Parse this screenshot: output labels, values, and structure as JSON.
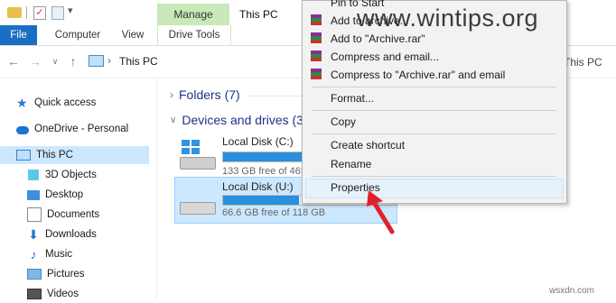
{
  "window": {
    "title": "This PC",
    "manage_tab": "Manage"
  },
  "ribbon": {
    "tabs": [
      "File",
      "Computer",
      "View",
      "Drive Tools"
    ]
  },
  "address": {
    "path": "This PC",
    "path_right_fragment": "This PC"
  },
  "sidebar": {
    "items": [
      {
        "label": "Quick access",
        "icon": "star-icon"
      },
      {
        "label": "OneDrive - Personal",
        "icon": "cloud-icon"
      },
      {
        "label": "This PC",
        "icon": "computer-icon",
        "selected": true
      },
      {
        "label": "3D Objects",
        "icon": "cube-icon"
      },
      {
        "label": "Desktop",
        "icon": "desktop-folder-icon"
      },
      {
        "label": "Documents",
        "icon": "documents-icon"
      },
      {
        "label": "Downloads",
        "icon": "download-icon"
      },
      {
        "label": "Music",
        "icon": "music-icon"
      },
      {
        "label": "Pictures",
        "icon": "pictures-icon"
      },
      {
        "label": "Videos",
        "icon": "videos-icon"
      }
    ]
  },
  "main": {
    "groups": [
      {
        "label": "Folders (7)",
        "expanded": false
      },
      {
        "label": "Devices and drives (3)",
        "expanded": true
      }
    ],
    "drives": [
      {
        "name": "Local Disk (C:)",
        "info": "133 GB free of 465",
        "used_fraction": 0.71,
        "selected": false
      },
      {
        "name": "Local Disk (U:)",
        "info": "66.6 GB free of 118 GB",
        "used_fraction": 0.44,
        "selected": true
      }
    ]
  },
  "context_menu": {
    "items": [
      {
        "label": "Pin to Start",
        "rar": false
      },
      {
        "label": "Add to archive...",
        "rar": true
      },
      {
        "label": "Add to \"Archive.rar\"",
        "rar": true
      },
      {
        "label": "Compress and email...",
        "rar": true
      },
      {
        "label": "Compress to \"Archive.rar\" and email",
        "rar": true
      },
      {
        "label": "Format...",
        "rar": false
      },
      {
        "label": "Copy",
        "rar": false
      },
      {
        "label": "Create shortcut",
        "rar": false
      },
      {
        "label": "Rename",
        "rar": false
      },
      {
        "label": "Properties",
        "rar": false
      }
    ]
  },
  "watermark": "www.wintips.org",
  "credit": "wsxdn.com",
  "colors": {
    "accent": "#1a6fc4",
    "selection": "#cce8ff",
    "manage_tab": "#c9e9b8",
    "arrow": "#e0202a"
  }
}
